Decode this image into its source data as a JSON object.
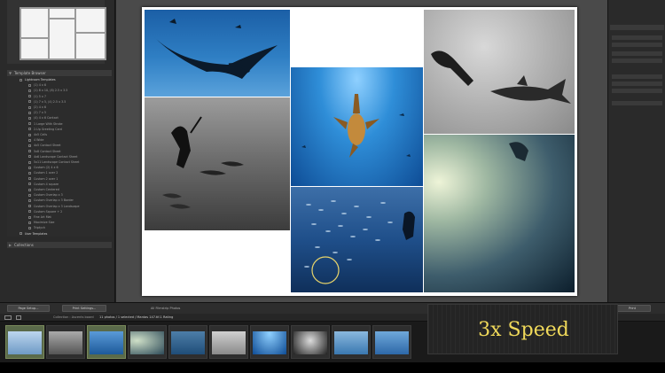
{
  "left_panel": {
    "template_browser": "Template Browser",
    "collections": "Collections",
    "templates": [
      {
        "label": "Lightroom Templates",
        "parent": true
      },
      {
        "label": "(1) 4 x 6",
        "parent": false
      },
      {
        "label": "(1) 8 x 10, (8) 2.5 x 3.5",
        "parent": false
      },
      {
        "label": "(1) 5 x 7",
        "parent": false
      },
      {
        "label": "(1) 7 x 5, (4) 2.5 x 3.5",
        "parent": false
      },
      {
        "label": "(2) 4 x 6",
        "parent": false
      },
      {
        "label": "(2) 7 x 5",
        "parent": false
      },
      {
        "label": "(4) 4 x 6 Contact",
        "parent": false
      },
      {
        "label": "1 Large With Stroke",
        "parent": false
      },
      {
        "label": "2-Up Greeting Card",
        "parent": false
      },
      {
        "label": "4x5 Cells",
        "parent": false
      },
      {
        "label": "4 Wide",
        "parent": false
      },
      {
        "label": "4x5 Contact Sheet",
        "parent": false
      },
      {
        "label": "5x8 Contact Sheet",
        "parent": false
      },
      {
        "label": "4x6 Landscape Contact Sheet",
        "parent": false
      },
      {
        "label": "5x11 Landscape Contact Sheet",
        "parent": false
      },
      {
        "label": "Custom (2) 4 x 6",
        "parent": false
      },
      {
        "label": "Custom 1 over 2",
        "parent": false
      },
      {
        "label": "Custom 2 over 1",
        "parent": false
      },
      {
        "label": "Custom 4 square",
        "parent": false
      },
      {
        "label": "Custom Centered",
        "parent": false
      },
      {
        "label": "Custom Overlap x 3",
        "parent": false
      },
      {
        "label": "Custom Overlap x 3 Border",
        "parent": false
      },
      {
        "label": "Custom Overlap x 3 Landscape",
        "parent": false
      },
      {
        "label": "Custom Square + 2",
        "parent": false
      },
      {
        "label": "Fine Art Mat",
        "parent": false
      },
      {
        "label": "Maximize Size",
        "parent": false
      },
      {
        "label": "Triptych",
        "parent": false
      },
      {
        "label": "User Templates",
        "parent": true
      }
    ]
  },
  "toolbar": {
    "page_setup": "Page Setup...",
    "print_settings": "Print Settings...",
    "photo_count": "All Filmstrip Photos",
    "print_button": "Print"
  },
  "filmstrip": {
    "source": "Collection : Ascents board",
    "count": "11 photos / 1 selected / Mantas 147.tif-1 Rating"
  },
  "overlay": {
    "speed_label": "3x Speed"
  },
  "colors": {
    "accent": "#f0d95a",
    "panel": "#2a2a2a",
    "canvas": "#4a4a4a"
  }
}
